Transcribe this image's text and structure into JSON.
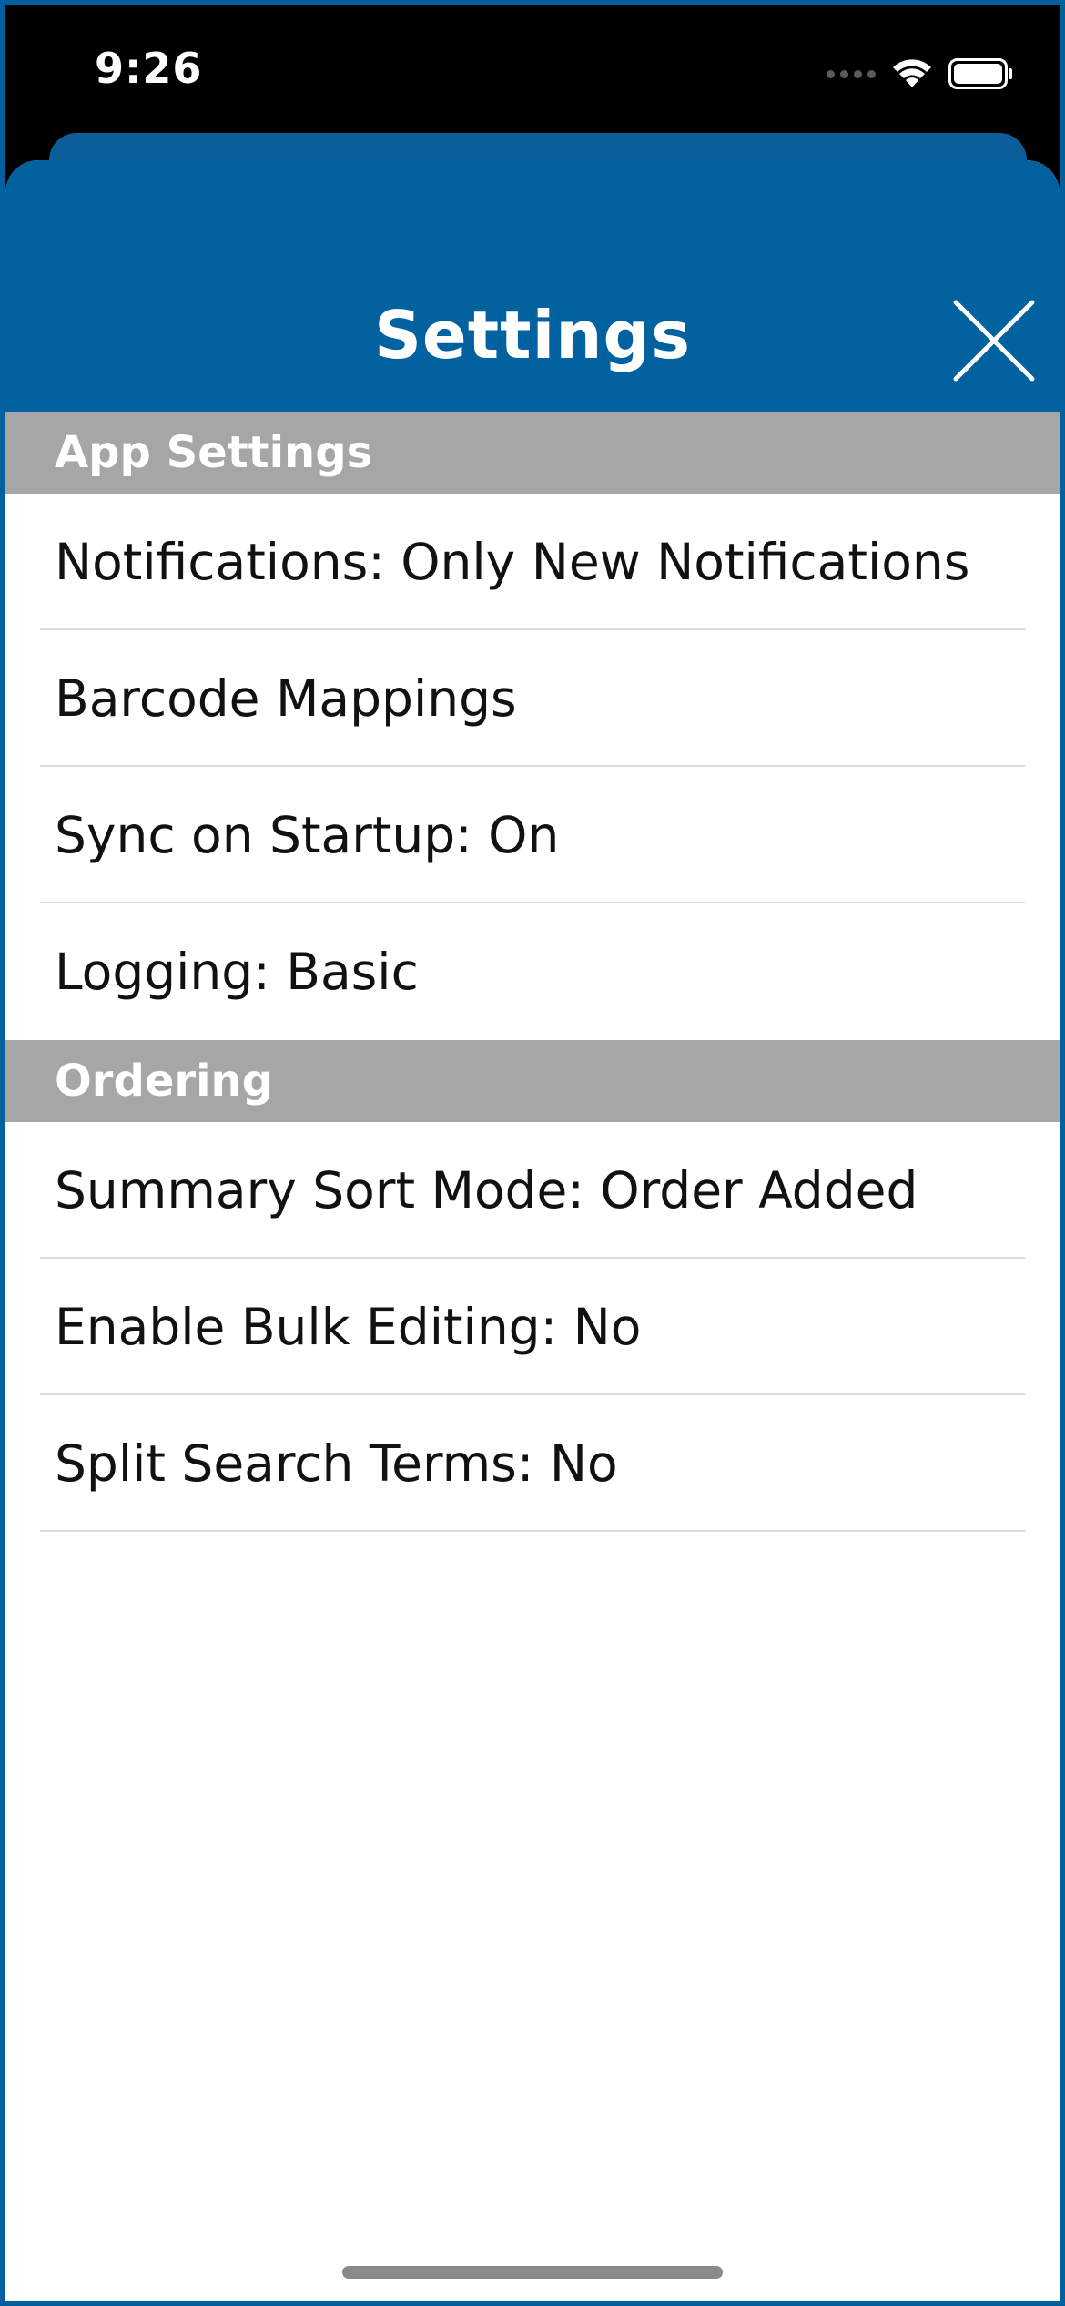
{
  "status_bar": {
    "time": "9:26",
    "icons": [
      "signal-icon",
      "wifi-icon",
      "battery-icon"
    ]
  },
  "header": {
    "title": "Settings",
    "close_icon": "close-icon"
  },
  "sections": [
    {
      "title": "App Settings",
      "items": [
        "Notifications: Only New Notifications",
        "Barcode Mappings",
        "Sync on Startup: On",
        "Logging: Basic"
      ]
    },
    {
      "title": "Ordering",
      "items": [
        "Summary Sort Mode: Order Added",
        "Enable Bulk Editing: No",
        "Split Search Terms: No"
      ]
    }
  ],
  "colors": {
    "brand_blue": "#02619f",
    "section_header_gray": "#a6a6a6",
    "divider": "#dcdcdc",
    "text": "#111111"
  }
}
